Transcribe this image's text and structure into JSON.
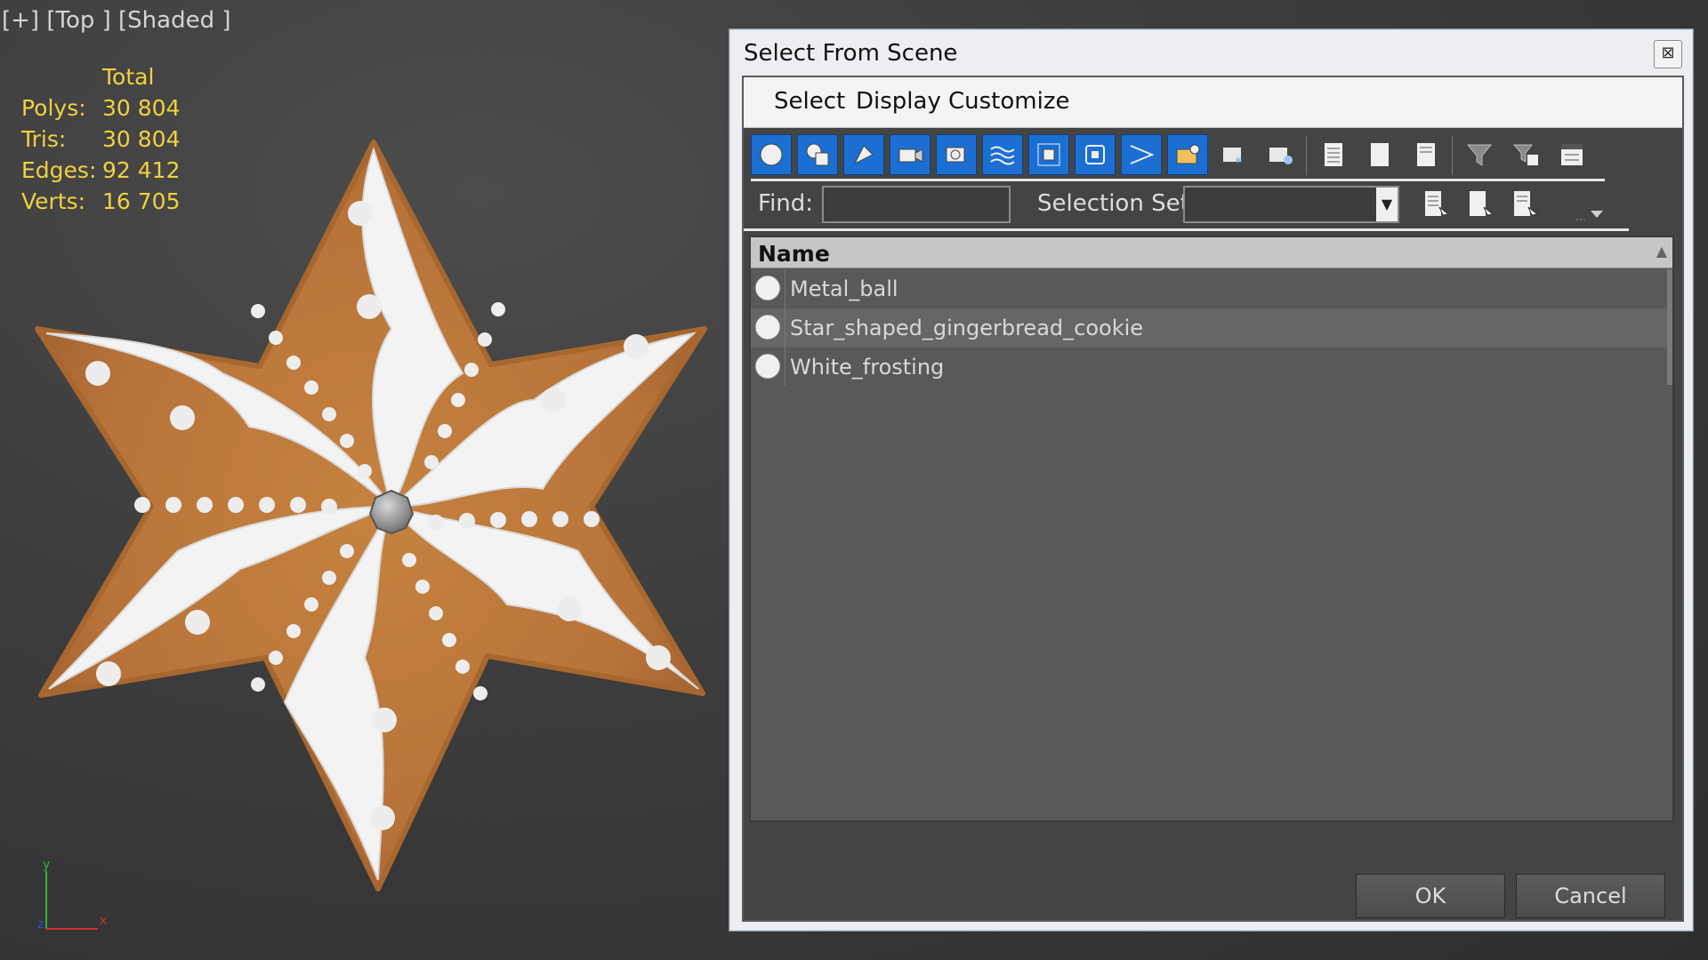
{
  "viewport": {
    "label": "[+] [Top ] [Shaded ]",
    "stats": {
      "header": "Total",
      "rows": [
        {
          "key": "Polys:",
          "value": "30 804"
        },
        {
          "key": "Tris:",
          "value": "30 804"
        },
        {
          "key": "Edges:",
          "value": "92 412"
        },
        {
          "key": "Verts:",
          "value": "16 705"
        }
      ]
    },
    "axis": {
      "x": "x",
      "y": "y",
      "z": "z"
    }
  },
  "dialog": {
    "title": "Select From Scene",
    "close_glyph": "⊠",
    "menu": [
      "Select",
      "Display",
      "Customize"
    ],
    "toolbar_icons": [
      "geometry-filter-icon",
      "shapes-filter-icon",
      "lights-filter-icon",
      "cameras-filter-icon",
      "helpers-filter-icon",
      "space-warps-filter-icon",
      "groups-filter-icon",
      "xrefs-filter-icon",
      "bones-filter-icon",
      "containers-filter-icon",
      "frozen-filter-icon",
      "hidden-filter-icon",
      "select-all-icon",
      "select-none-icon",
      "select-invert-icon",
      "filter-icon",
      "filter-options-icon",
      "hierarchy-icon"
    ],
    "find_label": "Find:",
    "find_value": "",
    "selection_set_label": "Selection Set:",
    "selection_set_value": "",
    "list": {
      "column": "Name",
      "sort_glyph": "▲",
      "items": [
        {
          "name": "Metal_ball"
        },
        {
          "name": "Star_shaped_gingerbread_cookie"
        },
        {
          "name": "White_frosting"
        }
      ]
    },
    "ok_label": "OK",
    "cancel_label": "Cancel"
  }
}
